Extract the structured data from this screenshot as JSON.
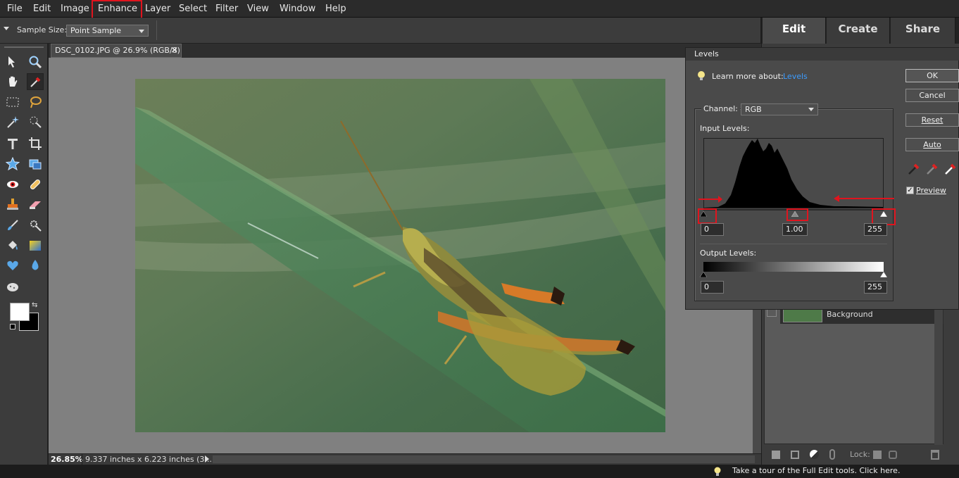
{
  "menu": [
    "File",
    "Edit",
    "Image",
    "Enhance",
    "Layer",
    "Select",
    "Filter",
    "View",
    "Window",
    "Help"
  ],
  "options": {
    "sample_size_label": "Sample Size:",
    "sample_size_value": "Point Sample"
  },
  "mode_tabs": [
    "Edit",
    "Create",
    "Share"
  ],
  "document": {
    "tab_title": "DSC_0102.JPG @ 26.9% (RGB/8) *",
    "close_glyph": "×",
    "zoom": "26.85%",
    "dimensions": "9.337 inches x 6.223 inches (3..."
  },
  "levels": {
    "title": "Levels",
    "learn_more_label": "Learn more about:",
    "learn_more_link": "Levels",
    "channel_label": "Channel:",
    "channel_value": "RGB",
    "input_levels_label": "Input Levels:",
    "input_black": "0",
    "input_gamma": "1.00",
    "input_white": "255",
    "output_levels_label": "Output Levels:",
    "output_black": "0",
    "output_white": "255",
    "buttons": {
      "ok": "OK",
      "cancel": "Cancel",
      "reset": "Reset",
      "auto": "Auto"
    },
    "preview_label": "Preview",
    "preview_checked": true
  },
  "layers": {
    "layer_name": "Background",
    "lock_label": "Lock:"
  },
  "bottom_tip": "Take a tour of the Full Edit tools. Click here.",
  "colors": {
    "highlight": "#e0141e",
    "link": "#3c9cff",
    "foreground_swatch": "#ffffff",
    "background_swatch": "#000000"
  }
}
